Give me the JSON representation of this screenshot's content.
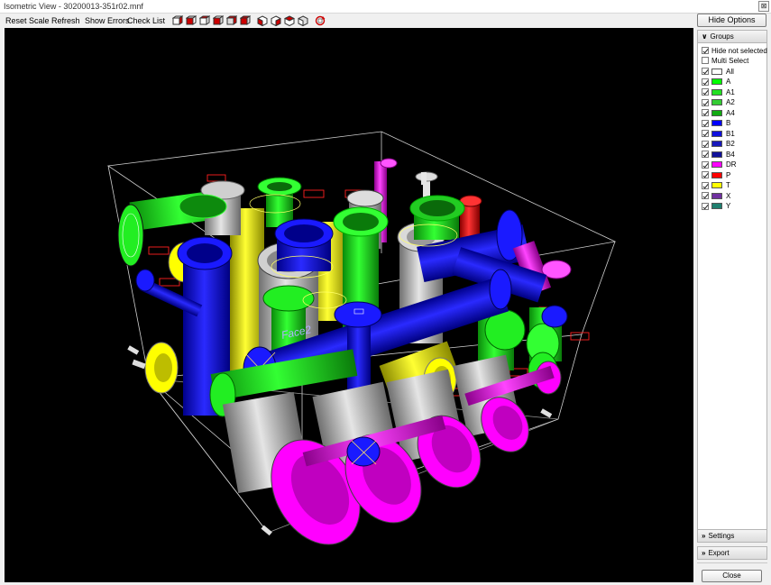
{
  "window": {
    "title": "Isometric View - 30200013-351r02.mnf",
    "close_glyph": "⊠"
  },
  "toolbar": {
    "reset_scale": "Reset Scale",
    "refresh": "Refresh",
    "show_errors": "Show Errors",
    "check_list": "Check List",
    "view_icons": [
      "view-front-icon",
      "view-back-icon",
      "view-left-icon",
      "view-right-icon",
      "view-top-icon",
      "view-bottom-icon"
    ],
    "iso_icons": [
      "iso-view-1-icon",
      "iso-view-2-icon",
      "iso-view-3-icon",
      "iso-view-4-icon"
    ],
    "rotate_icon": "rotate-icon"
  },
  "viewport": {
    "face_label": "Face2"
  },
  "side": {
    "hide_options": "Hide Options",
    "groups_header": "Groups",
    "hide_not_selected": {
      "label": "Hide not selected",
      "checked": true
    },
    "multi_select": {
      "label": "Multi Select",
      "checked": false
    },
    "groups": [
      {
        "label": "All",
        "color": "#ffffff",
        "checked": true
      },
      {
        "label": "A",
        "color": "#00ff00",
        "checked": true
      },
      {
        "label": "A1",
        "color": "#22e022",
        "checked": true
      },
      {
        "label": "A2",
        "color": "#33cc33",
        "checked": true
      },
      {
        "label": "A4",
        "color": "#11aa11",
        "checked": true
      },
      {
        "label": "B",
        "color": "#0000ff",
        "checked": true
      },
      {
        "label": "B1",
        "color": "#1010dd",
        "checked": true
      },
      {
        "label": "B2",
        "color": "#1818bb",
        "checked": true
      },
      {
        "label": "B4",
        "color": "#101099",
        "checked": true
      },
      {
        "label": "DR",
        "color": "#ff00ff",
        "checked": true
      },
      {
        "label": "P",
        "color": "#ff0000",
        "checked": true
      },
      {
        "label": "T",
        "color": "#ffff00",
        "checked": true
      },
      {
        "label": "X",
        "color": "#7030a0",
        "checked": true
      },
      {
        "label": "Y",
        "color": "#1f7f6f",
        "checked": true
      }
    ],
    "settings": "Settings",
    "export": "Export",
    "close": "Close"
  }
}
